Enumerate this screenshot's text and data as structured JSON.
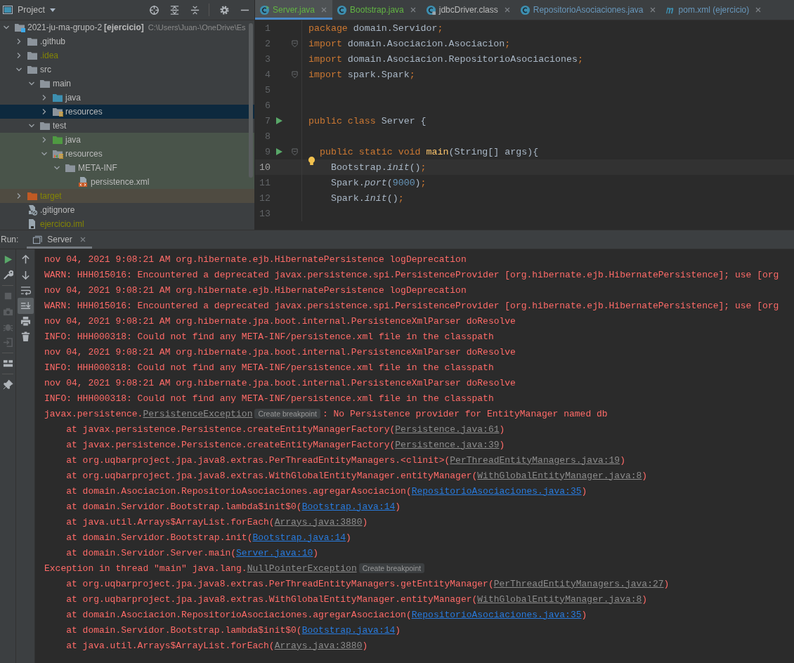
{
  "project_panel": {
    "title": "Project",
    "tree": {
      "name": "2021-ju-ma-grupo-2",
      "module": "[ejercicio]",
      "path": "C:\\Users\\Juan-\\OneDrive\\Es",
      "kind": "module",
      "expanded": true,
      "ignored": false,
      "selected": false,
      "children": [
        {
          "name": ".github",
          "kind": "folder",
          "expanded": false,
          "ignored": false,
          "selected": false
        },
        {
          "name": ".idea",
          "kind": "folder",
          "expanded": false,
          "ignored": true,
          "selected": false
        },
        {
          "name": "src",
          "kind": "folder",
          "expanded": true,
          "ignored": false,
          "selected": false,
          "children": [
            {
              "name": "main",
              "kind": "folder",
              "expanded": true,
              "ignored": false,
              "selected": false,
              "children": [
                {
                  "name": "java",
                  "kind": "source-folder",
                  "expanded": false,
                  "ignored": false,
                  "selected": false
                },
                {
                  "name": "resources",
                  "kind": "resources-folder",
                  "expanded": false,
                  "ignored": false,
                  "selected": true
                }
              ]
            },
            {
              "name": "test",
              "kind": "folder",
              "expanded": true,
              "ignored": false,
              "selected": false,
              "children": [
                {
                  "name": "java",
                  "kind": "test-folder",
                  "expanded": false,
                  "ignored": false,
                  "selected": false
                },
                {
                  "name": "resources",
                  "kind": "test-resources-folder",
                  "expanded": true,
                  "ignored": false,
                  "selected": false,
                  "children": [
                    {
                      "name": "META-INF",
                      "kind": "folder",
                      "expanded": true,
                      "ignored": false,
                      "selected": false,
                      "children": [
                        {
                          "name": "persistence.xml",
                          "kind": "xml-file",
                          "ignored": false,
                          "selected": false
                        }
                      ]
                    }
                  ]
                }
              ]
            }
          ]
        },
        {
          "name": "target",
          "kind": "excluded-folder",
          "expanded": false,
          "ignored": true,
          "selected": false
        },
        {
          "name": ".gitignore",
          "kind": "ignore-file",
          "ignored": false,
          "selected": false
        },
        {
          "name": "ejercicio.iml",
          "kind": "iml-file",
          "ignored": true,
          "selected": false
        }
      ]
    }
  },
  "editor": {
    "tabs": [
      {
        "label": "Server.java",
        "kind": "class-run",
        "color": "#62b543",
        "selected": true
      },
      {
        "label": "Bootstrap.java",
        "kind": "class",
        "color": "#62b543",
        "selected": false
      },
      {
        "label": "jdbcDriver.class",
        "kind": "class-locked",
        "color": "#bbbbbb",
        "selected": false
      },
      {
        "label": "RepositorioAsociaciones.java",
        "kind": "class",
        "color": "#6897bb",
        "selected": false
      },
      {
        "label": "pom.xml (ejercicio)",
        "kind": "maven",
        "color": "#6897bb",
        "selected": false
      }
    ],
    "lines": [
      {
        "number": "1",
        "current": false,
        "run": false,
        "fold": false,
        "bulb": false,
        "tokens": [
          {
            "kind": "keyword",
            "text": "package"
          },
          {
            "kind": "plain",
            "text": " domain.Servidor"
          },
          {
            "kind": "keyword",
            "text": ";"
          }
        ]
      },
      {
        "number": "2",
        "current": false,
        "run": false,
        "fold": true,
        "bulb": false,
        "tokens": [
          {
            "kind": "keyword",
            "text": "import"
          },
          {
            "kind": "plain",
            "text": " domain.Asociacion.Asociacion"
          },
          {
            "kind": "keyword",
            "text": ";"
          }
        ]
      },
      {
        "number": "3",
        "current": false,
        "run": false,
        "fold": false,
        "bulb": false,
        "tokens": [
          {
            "kind": "keyword",
            "text": "import"
          },
          {
            "kind": "plain",
            "text": " domain.Asociacion.RepositorioAsociaciones"
          },
          {
            "kind": "keyword",
            "text": ";"
          }
        ]
      },
      {
        "number": "4",
        "current": false,
        "run": false,
        "fold": true,
        "bulb": false,
        "tokens": [
          {
            "kind": "keyword",
            "text": "import"
          },
          {
            "kind": "plain",
            "text": " spark.Spark"
          },
          {
            "kind": "keyword",
            "text": ";"
          }
        ]
      },
      {
        "number": "5",
        "current": false,
        "run": false,
        "fold": false,
        "bulb": false
      },
      {
        "number": "6",
        "current": false,
        "run": false,
        "fold": false,
        "bulb": false
      },
      {
        "number": "7",
        "current": false,
        "run": true,
        "fold": false,
        "bulb": false,
        "tokens": [
          {
            "kind": "keyword",
            "text": "public class"
          },
          {
            "kind": "plain",
            "text": " Server {"
          }
        ]
      },
      {
        "number": "8",
        "current": false,
        "run": false,
        "fold": false,
        "bulb": false
      },
      {
        "number": "9",
        "current": false,
        "run": true,
        "fold": true,
        "bulb": false,
        "tokens": [
          {
            "kind": "keyword",
            "text": "  public static void"
          },
          {
            "kind": "method",
            "text": " main"
          },
          {
            "kind": "plain",
            "text": "(String[] args){"
          }
        ]
      },
      {
        "number": "10",
        "current": true,
        "run": false,
        "fold": false,
        "bulb": true,
        "tokens": [
          {
            "kind": "plain",
            "text": "    Bootstrap."
          },
          {
            "kind": "static",
            "text": "init"
          },
          {
            "kind": "plain",
            "text": "()"
          },
          {
            "kind": "keyword",
            "text": ";"
          }
        ]
      },
      {
        "number": "11",
        "current": false,
        "run": false,
        "fold": false,
        "bulb": false,
        "tokens": [
          {
            "kind": "plain",
            "text": "    Spark."
          },
          {
            "kind": "static",
            "text": "port"
          },
          {
            "kind": "plain",
            "text": "("
          },
          {
            "kind": "number",
            "text": "9000"
          },
          {
            "kind": "plain",
            "text": ")"
          },
          {
            "kind": "keyword",
            "text": ";"
          }
        ]
      },
      {
        "number": "12",
        "current": false,
        "run": false,
        "fold": false,
        "bulb": false,
        "tokens": [
          {
            "kind": "plain",
            "text": "    Spark."
          },
          {
            "kind": "static",
            "text": "init"
          },
          {
            "kind": "plain",
            "text": "()"
          },
          {
            "kind": "keyword",
            "text": ";"
          }
        ]
      },
      {
        "number": "13",
        "current": false,
        "run": false,
        "fold": false,
        "bulb": false
      }
    ]
  },
  "run_panel": {
    "label": "Run:",
    "tabs": [
      {
        "label": "Server",
        "selected": true
      }
    ],
    "console": [
      [
        {
          "kind": "text",
          "text": "nov 04, 2021 9:08:21 AM org.hibernate.ejb.HibernatePersistence logDeprecation"
        }
      ],
      [
        {
          "kind": "text",
          "text": "WARN: HHH015016: Encountered a deprecated javax.persistence.spi.PersistenceProvider [org.hibernate.ejb.HibernatePersistence]; use [org"
        }
      ],
      [
        {
          "kind": "text",
          "text": "nov 04, 2021 9:08:21 AM org.hibernate.ejb.HibernatePersistence logDeprecation"
        }
      ],
      [
        {
          "kind": "text",
          "text": "WARN: HHH015016: Encountered a deprecated javax.persistence.spi.PersistenceProvider [org.hibernate.ejb.HibernatePersistence]; use [org"
        }
      ],
      [
        {
          "kind": "text",
          "text": "nov 04, 2021 9:08:21 AM org.hibernate.jpa.boot.internal.PersistenceXmlParser doResolve"
        }
      ],
      [
        {
          "kind": "text",
          "text": "INFO: HHH000318: Could not find any META-INF/persistence.xml file in the classpath"
        }
      ],
      [
        {
          "kind": "text",
          "text": "nov 04, 2021 9:08:21 AM org.hibernate.jpa.boot.internal.PersistenceXmlParser doResolve"
        }
      ],
      [
        {
          "kind": "text",
          "text": "INFO: HHH000318: Could not find any META-INF/persistence.xml file in the classpath"
        }
      ],
      [
        {
          "kind": "text",
          "text": "nov 04, 2021 9:08:21 AM org.hibernate.jpa.boot.internal.PersistenceXmlParser doResolve"
        }
      ],
      [
        {
          "kind": "text",
          "text": "INFO: HHH000318: Could not find any META-INF/persistence.xml file in the classpath"
        }
      ],
      [
        {
          "kind": "text",
          "text": "javax.persistence."
        },
        {
          "kind": "library-link",
          "text": "PersistenceException"
        },
        {
          "kind": "hint",
          "text": "Create breakpoint"
        },
        {
          "kind": "text",
          "text": ": No Persistence provider for EntityManager named db"
        }
      ],
      [
        {
          "kind": "text",
          "text": "    at javax.persistence.Persistence.createEntityManagerFactory("
        },
        {
          "kind": "library-link",
          "text": "Persistence.java:61"
        },
        {
          "kind": "text",
          "text": ")"
        }
      ],
      [
        {
          "kind": "text",
          "text": "    at javax.persistence.Persistence.createEntityManagerFactory("
        },
        {
          "kind": "library-link",
          "text": "Persistence.java:39"
        },
        {
          "kind": "text",
          "text": ")"
        }
      ],
      [
        {
          "kind": "text",
          "text": "    at org.uqbarproject.jpa.java8.extras.PerThreadEntityManagers.<clinit>("
        },
        {
          "kind": "library-link",
          "text": "PerThreadEntityManagers.java:19"
        },
        {
          "kind": "text",
          "text": ")"
        }
      ],
      [
        {
          "kind": "text",
          "text": "    at org.uqbarproject.jpa.java8.extras.WithGlobalEntityManager.entityManager("
        },
        {
          "kind": "library-link",
          "text": "WithGlobalEntityManager.java:8"
        },
        {
          "kind": "text",
          "text": ")"
        }
      ],
      [
        {
          "kind": "text",
          "text": "    at domain.Asociacion.RepositorioAsociaciones.agregarAsociacion("
        },
        {
          "kind": "link",
          "text": "RepositorioAsociaciones.java:35"
        },
        {
          "kind": "text",
          "text": ")"
        }
      ],
      [
        {
          "kind": "text",
          "text": "    at domain.Servidor.Bootstrap.lambda$init$0("
        },
        {
          "kind": "link",
          "text": "Bootstrap.java:14"
        },
        {
          "kind": "text",
          "text": ")"
        }
      ],
      [
        {
          "kind": "text",
          "text": "    at java.util.Arrays$ArrayList.forEach("
        },
        {
          "kind": "library-link",
          "text": "Arrays.java:3880"
        },
        {
          "kind": "text",
          "text": ")"
        }
      ],
      [
        {
          "kind": "text",
          "text": "    at domain.Servidor.Bootstrap.init("
        },
        {
          "kind": "link",
          "text": "Bootstrap.java:14"
        },
        {
          "kind": "text",
          "text": ")"
        }
      ],
      [
        {
          "kind": "text",
          "text": "    at domain.Servidor.Server.main("
        },
        {
          "kind": "link",
          "text": "Server.java:10"
        },
        {
          "kind": "text",
          "text": ")"
        }
      ],
      [
        {
          "kind": "text",
          "text": "Exception in thread \"main\" java.lang."
        },
        {
          "kind": "library-link",
          "text": "NullPointerException"
        },
        {
          "kind": "hint",
          "text": "Create breakpoint"
        }
      ],
      [
        {
          "kind": "text",
          "text": "    at org.uqbarproject.jpa.java8.extras.PerThreadEntityManagers.getEntityManager("
        },
        {
          "kind": "library-link",
          "text": "PerThreadEntityManagers.java:27"
        },
        {
          "kind": "text",
          "text": ")"
        }
      ],
      [
        {
          "kind": "text",
          "text": "    at org.uqbarproject.jpa.java8.extras.WithGlobalEntityManager.entityManager("
        },
        {
          "kind": "library-link",
          "text": "WithGlobalEntityManager.java:8"
        },
        {
          "kind": "text",
          "text": ")"
        }
      ],
      [
        {
          "kind": "text",
          "text": "    at domain.Asociacion.RepositorioAsociaciones.agregarAsociacion("
        },
        {
          "kind": "link",
          "text": "RepositorioAsociaciones.java:35"
        },
        {
          "kind": "text",
          "text": ")"
        }
      ],
      [
        {
          "kind": "text",
          "text": "    at domain.Servidor.Bootstrap.lambda$init$0("
        },
        {
          "kind": "link",
          "text": "Bootstrap.java:14"
        },
        {
          "kind": "text",
          "text": ")"
        }
      ],
      [
        {
          "kind": "text",
          "text": "    at java.util.Arrays$ArrayList.forEach("
        },
        {
          "kind": "library-link",
          "text": "Arrays.java:3880"
        },
        {
          "kind": "text",
          "text": ")"
        }
      ]
    ]
  }
}
